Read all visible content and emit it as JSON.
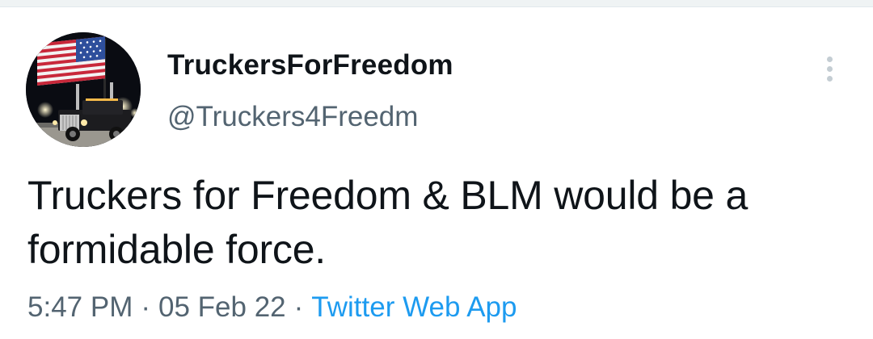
{
  "tweet": {
    "author": {
      "display_name": "TruckersForFreedom",
      "handle": "@Truckers4Freedm",
      "avatar_icon": "truck-with-american-flag-avatar"
    },
    "more_icon": "vertical-ellipsis-icon",
    "text": "Truckers for Freedom & BLM would be a formidable force.",
    "time": "5:47 PM",
    "separator": "·",
    "date": "05 Feb 22",
    "source": "Twitter Web App"
  },
  "colors": {
    "text_primary": "#0f1419",
    "text_secondary": "#536471",
    "link": "#1d9bf0",
    "more_dots": "#c4cdd3"
  }
}
